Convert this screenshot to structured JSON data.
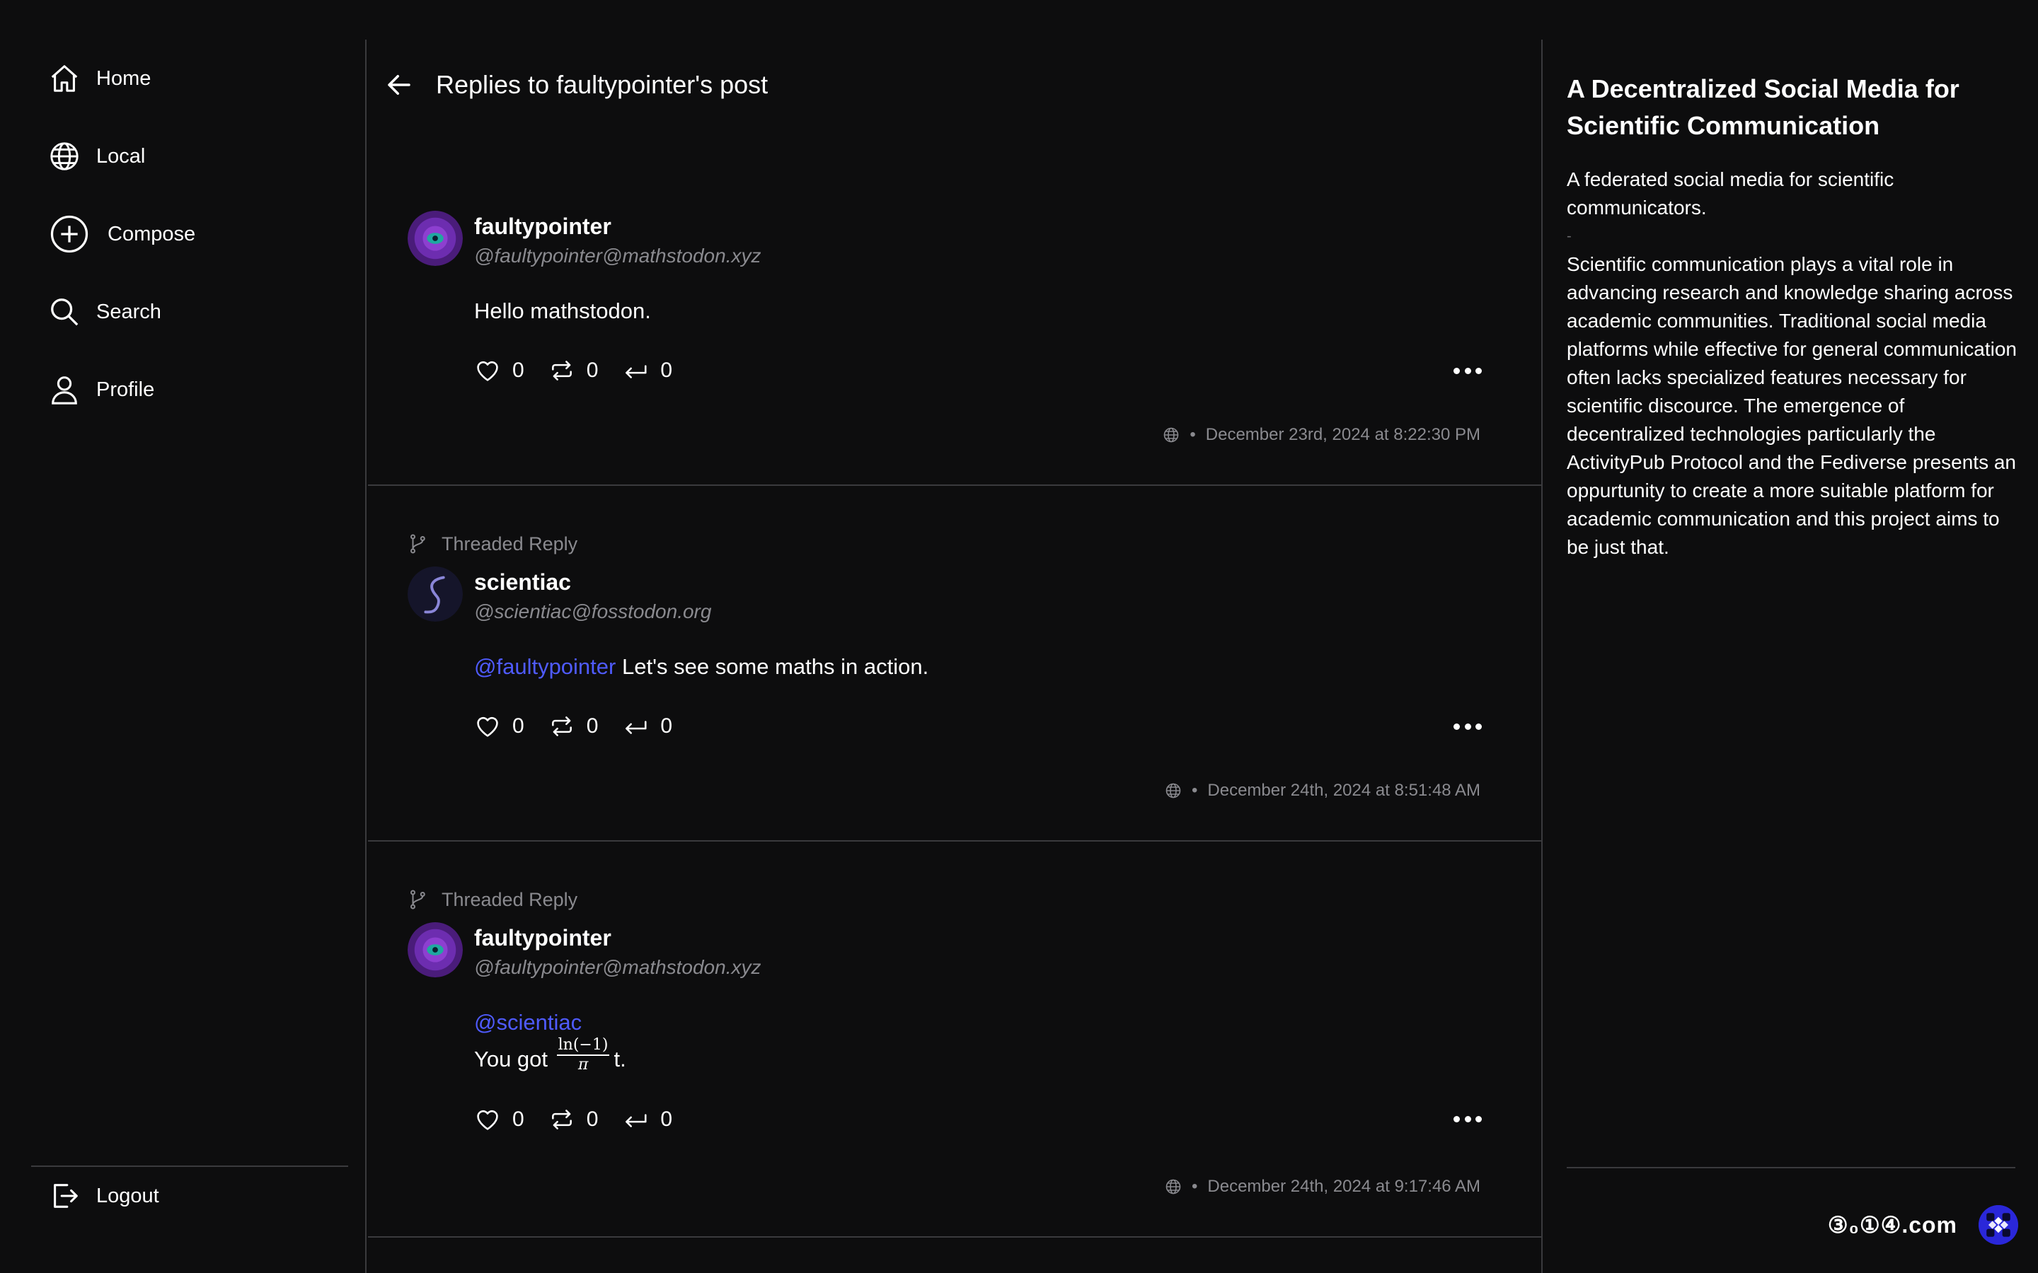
{
  "sidebar": {
    "items": [
      {
        "label": "Home",
        "icon": "home-icon"
      },
      {
        "label": "Local",
        "icon": "globe-icon"
      },
      {
        "label": "Compose",
        "icon": "plus-circle-icon"
      },
      {
        "label": "Search",
        "icon": "search-icon"
      },
      {
        "label": "Profile",
        "icon": "user-icon"
      }
    ],
    "logout_label": "Logout"
  },
  "header": {
    "title": "Replies to faultypointer's post"
  },
  "posts": [
    {
      "display_name": "faultypointer",
      "handle": "@faultypointer@mathstodon.xyz",
      "content": "Hello mathstodon.",
      "likes": "0",
      "boosts": "0",
      "replies": "0",
      "timestamp": "December 23rd, 2024 at 8:22:30 PM"
    },
    {
      "thread_label": "Threaded Reply",
      "display_name": "scientiac",
      "handle": "@scientiac@fosstodon.org",
      "mention": "@faultypointer",
      "content": " Let's see some maths in action.",
      "likes": "0",
      "boosts": "0",
      "replies": "0",
      "timestamp": "December 24th, 2024 at 8:51:48 AM"
    },
    {
      "thread_label": "Threaded Reply",
      "display_name": "faultypointer",
      "handle": "@faultypointer@mathstodon.xyz",
      "mention": "@scientiac",
      "content_prefix": "You got ",
      "math_numerator": "ln(−1)",
      "math_denominator": "π",
      "content_suffix": "t.",
      "likes": "0",
      "boosts": "0",
      "replies": "0",
      "timestamp": "December 24th, 2024 at 9:17:46 AM"
    }
  ],
  "about": {
    "title": "A Decentralized Social Media for Scientific Communication",
    "intro": "A federated social media for scientific communicators.",
    "separator": "-",
    "body": "Scientific communication plays a vital role in advancing research and knowledge sharing across academic communities. Traditional social media platforms while effective for general communication often lacks specialized features necessary for scientific discource. The emergence of decentralized technologies particularly the ActivityPub Protocol and the Fediverse presents an oppurtunity to create a more suitable platform for academic communication and this project aims to be just that."
  },
  "brand": {
    "name": "③₀①④.com",
    "logo_color": "#2a27d9"
  },
  "colors": {
    "background": "#0d0d0e",
    "mention": "#4f5bff",
    "muted": "#8a8a8f",
    "divider": "#3a3a3d"
  }
}
